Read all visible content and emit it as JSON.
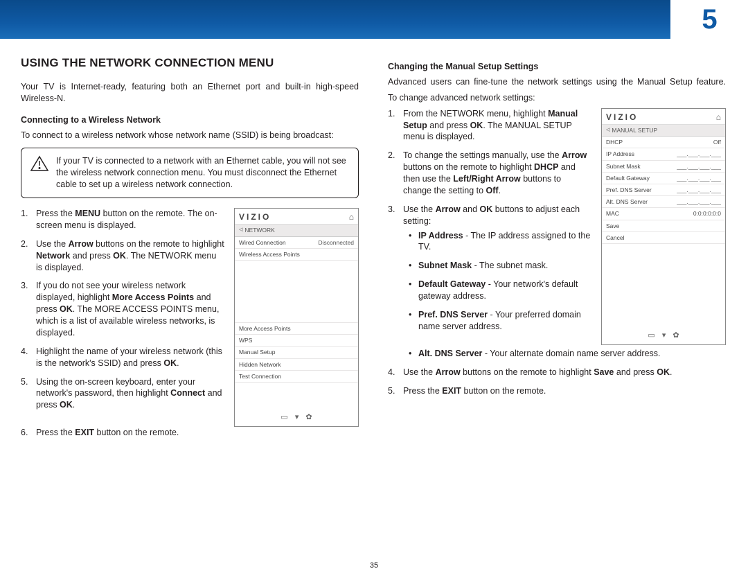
{
  "chapter": "5",
  "page_number": "35",
  "left": {
    "h1": "USING THE NETWORK CONNECTION MENU",
    "intro": "Your TV is Internet-ready, featuring both an Ethernet port and built-in high-speed Wireless-N.",
    "sub1": "Connecting to a Wireless Network",
    "p1": "To connect to a wireless network whose network name (SSID) is being broadcast:",
    "warn": "If your TV is connected to a network with an Ethernet cable, you will not see the wireless network connection menu. You must disconnect the Ethernet cable to set up a wireless network connection.",
    "steps": {
      "s1a": "Press the ",
      "s1b": "MENU",
      "s1c": " button on the remote. The on-screen menu is displayed.",
      "s2a": "Use the ",
      "s2b": "Arrow",
      "s2c": " buttons on the remote to highlight ",
      "s2d": "Network",
      "s2e": " and press ",
      "s2f": "OK",
      "s2g": ". The NETWORK menu is displayed.",
      "s3a": "If you do not see your wireless network displayed, highlight ",
      "s3b": "More Access Points",
      "s3c": " and press ",
      "s3d": "OK",
      "s3e": ". The MORE ACCESS POINTS menu, which is a list of available wireless networks, is displayed.",
      "s4a": "Highlight the name of your wireless network (this is the network's SSID) and press ",
      "s4b": "OK",
      "s4c": ".",
      "s5a": "Using the on-screen keyboard, enter your network's password, then highlight ",
      "s5b": "Connect",
      "s5c": " and press ",
      "s5d": "OK",
      "s5e": ".",
      "s6a": "Press the ",
      "s6b": "EXIT",
      "s6c": " button on the remote."
    },
    "ss": {
      "brand": "VIZIO",
      "crumb": "NETWORK",
      "r1l": "Wired Connection",
      "r1r": "Disconnected",
      "r2": "Wireless Access Points",
      "r3": "More Access Points",
      "r4": "WPS",
      "r5": "Manual Setup",
      "r6": "Hidden Network",
      "r7": "Test Connection"
    }
  },
  "right": {
    "sub1": "Changing the Manual Setup Settings",
    "p1": "Advanced users can fine-tune the network settings using the Manual Setup feature.",
    "p2": "To change advanced network settings:",
    "steps": {
      "s1a": "From the NETWORK menu, highlight ",
      "s1b": "Manual Setup",
      "s1c": " and press ",
      "s1d": "OK",
      "s1e": ". The MANUAL SETUP menu is displayed.",
      "s2a": "To change the settings manually, use the ",
      "s2b": "Arrow",
      "s2c": " buttons on the remote to highlight ",
      "s2d": "DHCP",
      "s2e": " and then use the ",
      "s2f": "Left/Right Arrow",
      "s2g": " buttons to change the setting to ",
      "s2h": "Off",
      "s2i": ".",
      "s3a": "Use the ",
      "s3b": "Arrow",
      "s3c": " and ",
      "s3d": "OK",
      "s3e": " buttons to adjust each setting:",
      "b1a": "IP Address",
      "b1b": " - The IP address assigned to the TV.",
      "b2a": "Subnet Mask",
      "b2b": " - The subnet mask.",
      "b3a": "Default Gateway",
      "b3b": " - Your network's default gateway address.",
      "b4a": "Pref. DNS Server",
      "b4b": " - Your preferred domain name server address.",
      "b5a": "Alt. DNS Server",
      "b5b": " - Your alternate domain name server address.",
      "s4a": "Use the ",
      "s4b": "Arrow",
      "s4c": " buttons on the remote to highlight ",
      "s4d": "Save",
      "s4e": " and press ",
      "s4f": "OK",
      "s4g": ".",
      "s5a": "Press the ",
      "s5b": "EXIT",
      "s5c": " button on the remote."
    },
    "ss": {
      "brand": "VIZIO",
      "crumb": "MANUAL SETUP",
      "r1l": "DHCP",
      "r1r": "Off",
      "r2l": "IP Address",
      "r2r": "___.___.___.___",
      "r3l": "Subnet Mask",
      "r3r": "___.___.___.___",
      "r4l": "Default Gateway",
      "r4r": "___.___.___.___",
      "r5l": "Pref. DNS Server",
      "r5r": "___.___.___.___",
      "r6l": "Alt. DNS Server",
      "r6r": "___.___.___.___",
      "r7l": "MAC",
      "r7r": "0:0:0:0:0:0",
      "r8": "Save",
      "r9": "Cancel"
    }
  }
}
